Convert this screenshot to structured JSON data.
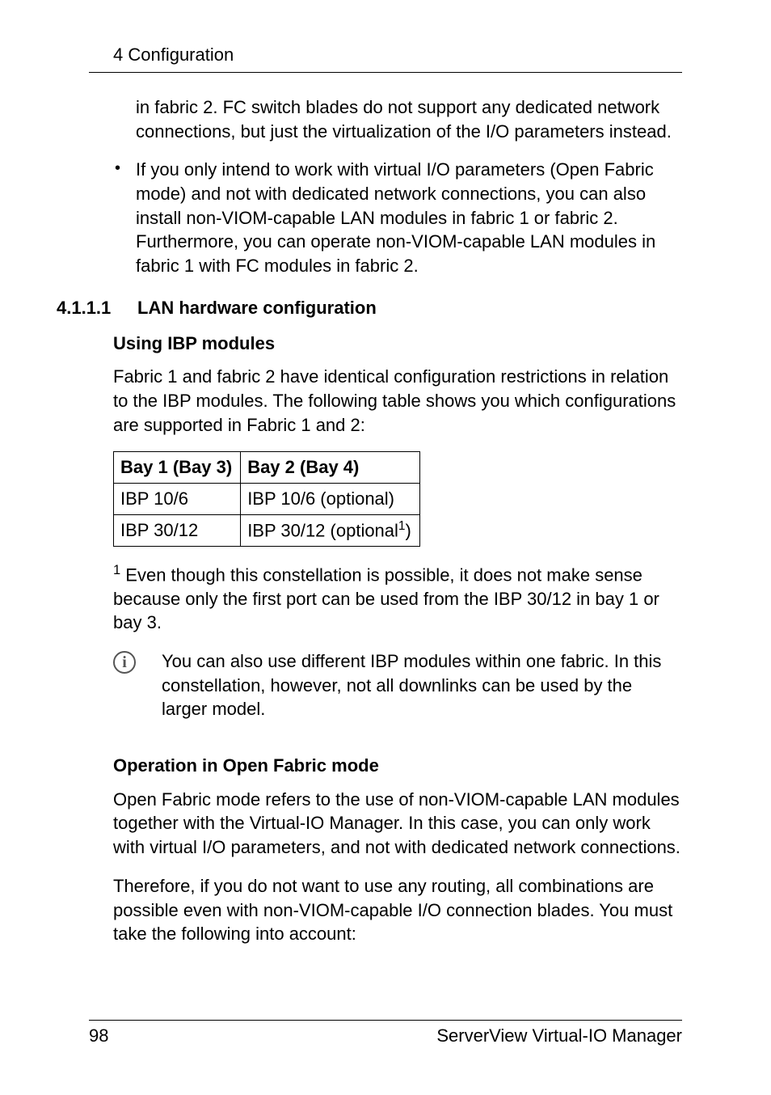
{
  "header": {
    "running_head": "4 Configuration"
  },
  "body": {
    "p_fabric2": "in fabric 2. FC switch blades do not support any dedicated network connections, but just the virtualization of the I/O parameters instead.",
    "bullet_openfabric": "If you only intend to work with virtual I/O parameters (Open Fabric mode) and not with dedicated network connections, you can also install non-VIOM-capable LAN modules in fabric 1 or fabric 2. Furthermore, you can operate non-VIOM-capable LAN modules in fabric 1 with FC modules in fabric 2.",
    "section": {
      "number": "4.1.1.1",
      "title": "LAN hardware configuration"
    },
    "using_ibp": {
      "heading": "Using IBP modules",
      "intro": "Fabric 1 and fabric 2 have identical configuration restrictions in relation to the IBP modules. The following table shows you which configurations are supported in Fabric 1 and 2:"
    },
    "table": {
      "headers": {
        "bay1": "Bay 1 (Bay 3)",
        "bay2": "Bay 2 (Bay 4)"
      },
      "rows": [
        {
          "bay1": "IBP 10/6",
          "bay2": "IBP 10/6 (optional)"
        },
        {
          "bay1": "IBP 30/12",
          "bay2_prefix": "IBP 30/12 (optional",
          "bay2_sup": "1",
          "bay2_suffix": ")"
        }
      ]
    },
    "footnote": {
      "marker": "1",
      "text": " Even though this constellation is possible, it does not make sense because only the first port can be used from the IBP 30/12 in bay 1 or bay 3."
    },
    "note": {
      "text": "You can also use different IBP modules within one fabric. In this constellation, however, not all downlinks can be used by the larger model."
    },
    "open_fabric": {
      "heading": "Operation in Open Fabric mode",
      "p1": "Open Fabric mode refers to the use of non-VIOM-capable LAN modules together with the Virtual-IO Manager. In this case, you can only work with virtual I/O parameters, and not with dedicated network connections.",
      "p2": "Therefore, if you do not want to use any routing, all combinations are possible even with non-VIOM-capable I/O connection blades. You must take the following into account:"
    }
  },
  "footer": {
    "page": "98",
    "doc": "ServerView Virtual-IO Manager"
  },
  "icons": {
    "info_letter": "i"
  }
}
